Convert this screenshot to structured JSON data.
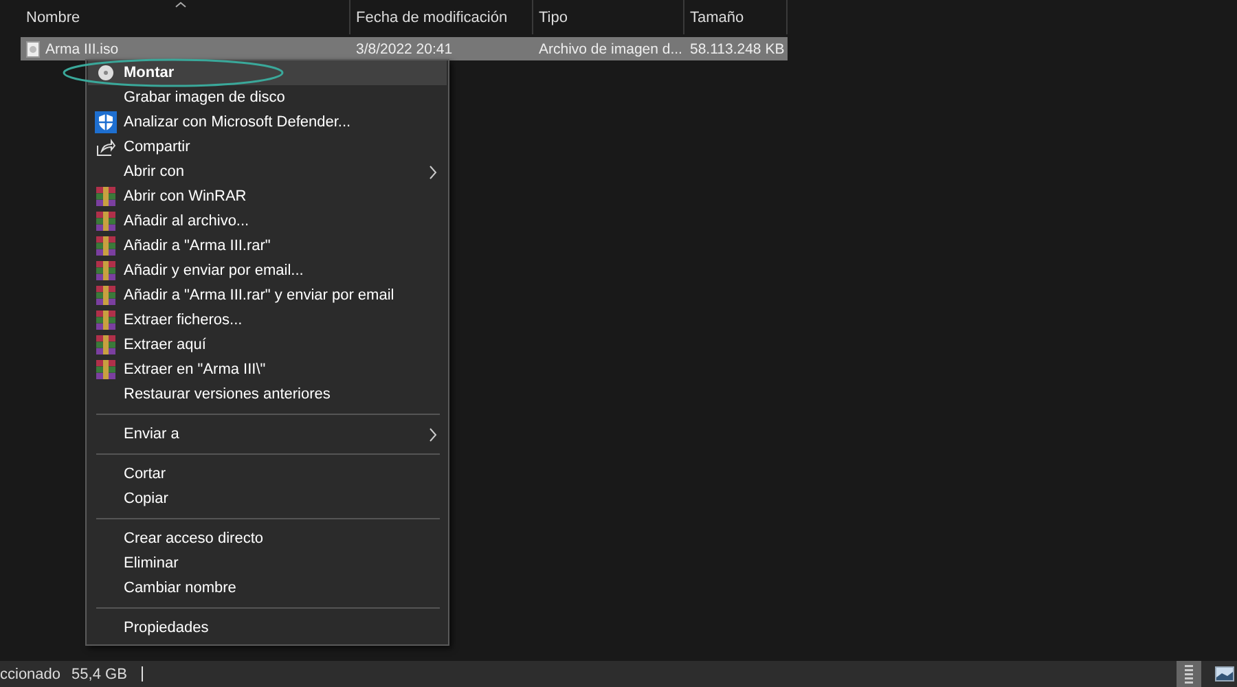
{
  "columns": [
    {
      "label": "Nombre",
      "sorted": true
    },
    {
      "label": "Fecha de modificación",
      "sorted": false
    },
    {
      "label": "Tipo",
      "sorted": false
    },
    {
      "label": "Tamaño",
      "sorted": false
    }
  ],
  "rows": [
    {
      "cells": [
        "Arma III.iso",
        "3/8/2022 20:41",
        "Archivo de imagen d...",
        "58.113.248 KB"
      ],
      "selected": true
    }
  ],
  "context_menu": {
    "items": [
      {
        "kind": "disc",
        "label": "Montar",
        "default": true,
        "selected": true,
        "submenu": false
      },
      {
        "kind": "plain",
        "label": "Grabar imagen de disco",
        "default": false,
        "selected": false,
        "submenu": false
      },
      {
        "kind": "shield",
        "label": "Analizar con Microsoft Defender...",
        "default": false,
        "selected": false,
        "submenu": false
      },
      {
        "kind": "share",
        "label": "Compartir",
        "default": false,
        "selected": false,
        "submenu": false
      },
      {
        "kind": "plain",
        "label": "Abrir con",
        "default": false,
        "selected": false,
        "submenu": true
      },
      {
        "kind": "archive",
        "label": "Abrir con WinRAR",
        "default": false,
        "selected": false,
        "submenu": false
      },
      {
        "kind": "archive",
        "label": "Añadir al archivo...",
        "default": false,
        "selected": false,
        "submenu": false
      },
      {
        "kind": "archive",
        "label": "Añadir a \"Arma III.rar\"",
        "default": false,
        "selected": false,
        "submenu": false
      },
      {
        "kind": "archive",
        "label": "Añadir y enviar por email...",
        "default": false,
        "selected": false,
        "submenu": false
      },
      {
        "kind": "archive",
        "label": "Añadir a \"Arma III.rar\" y enviar por email",
        "default": false,
        "selected": false,
        "submenu": false
      },
      {
        "kind": "archive",
        "label": "Extraer ficheros...",
        "default": false,
        "selected": false,
        "submenu": false
      },
      {
        "kind": "archive",
        "label": "Extraer aquí",
        "default": false,
        "selected": false,
        "submenu": false
      },
      {
        "kind": "archive",
        "label": "Extraer en \"Arma III\\\"",
        "default": false,
        "selected": false,
        "submenu": false
      },
      {
        "kind": "plain",
        "label": "Restaurar versiones anteriores",
        "default": false,
        "selected": false,
        "submenu": false
      },
      {
        "kind": "separator"
      },
      {
        "kind": "plain",
        "label": "Enviar a",
        "default": false,
        "selected": false,
        "submenu": true
      },
      {
        "kind": "separator"
      },
      {
        "kind": "plain",
        "label": "Cortar",
        "default": false,
        "selected": false,
        "submenu": false
      },
      {
        "kind": "plain",
        "label": "Copiar",
        "default": false,
        "selected": false,
        "submenu": false
      },
      {
        "kind": "separator"
      },
      {
        "kind": "plain",
        "label": "Crear acceso directo",
        "default": false,
        "selected": false,
        "submenu": false
      },
      {
        "kind": "plain",
        "label": "Eliminar",
        "default": false,
        "selected": false,
        "submenu": false
      },
      {
        "kind": "plain",
        "label": "Cambiar nombre",
        "default": false,
        "selected": false,
        "submenu": false
      },
      {
        "kind": "separator"
      },
      {
        "kind": "plain",
        "label": "Propiedades",
        "default": false,
        "selected": false,
        "submenu": false
      }
    ]
  },
  "status_bar": {
    "texts": [
      "ccionado",
      "55,4 GB"
    ],
    "views": [
      {
        "selected": true
      },
      {
        "selected": false
      }
    ]
  }
}
